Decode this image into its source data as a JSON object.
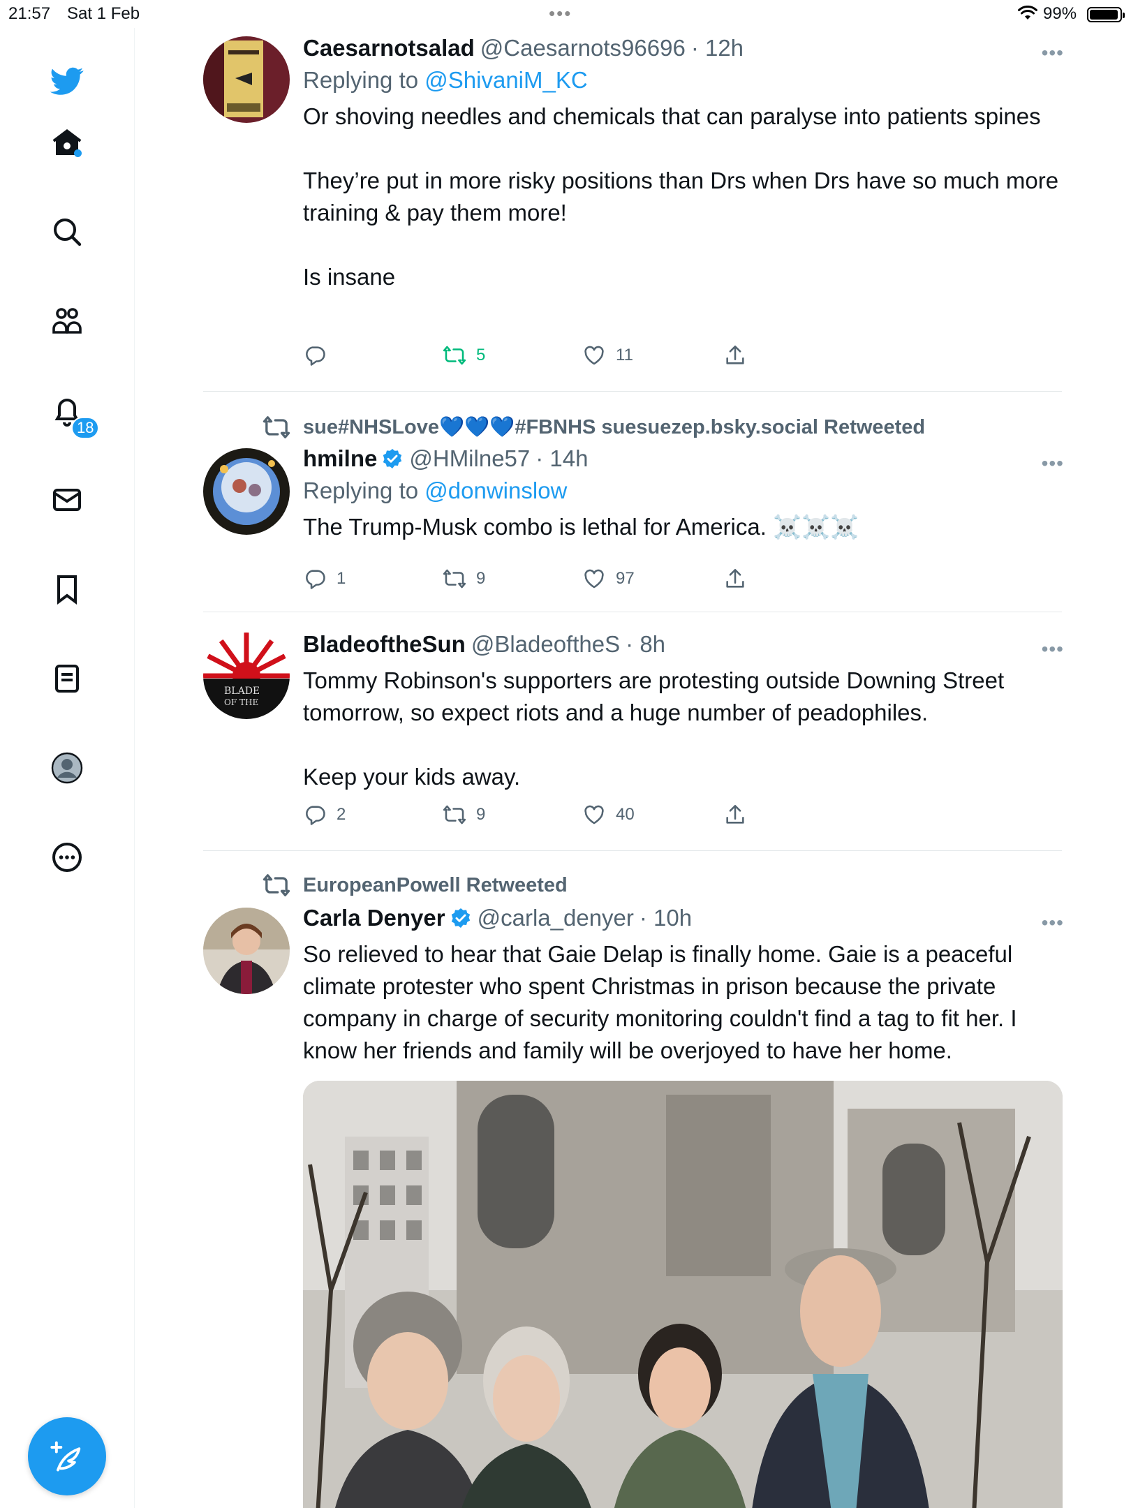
{
  "status_bar": {
    "time": "21:57",
    "date": "Sat 1 Feb",
    "battery": "99%"
  },
  "sidebar": {
    "items": [
      {
        "name": "home"
      },
      {
        "name": "search"
      },
      {
        "name": "communities"
      },
      {
        "name": "notifications",
        "badge": "18"
      },
      {
        "name": "messages"
      },
      {
        "name": "bookmarks"
      },
      {
        "name": "lists"
      },
      {
        "name": "profile"
      },
      {
        "name": "more"
      }
    ]
  },
  "tweets": [
    {
      "display_name": "Caesarnotsalad",
      "handle": "@Caesarnots96696",
      "time": "· 12h",
      "replying_label": "Replying to",
      "replying_to": "@ShivaniM_KC",
      "text": "Or shoving needles and chemicals that can paralyse into patients spines\n\nThey’re put in more risky positions than Drs when Drs have so much more training & pay them more!\n\nIs insane",
      "replies": "",
      "retweets": "5",
      "likes": "11"
    },
    {
      "retweeted_by": "sue#NHSLove💙💙💙#FBNHS suesuezep.bsky.social Retweeted",
      "display_name": "hmilne",
      "handle": "@HMilne57",
      "time": "· 14h",
      "replying_label": "Replying to",
      "replying_to": "@donwinslow",
      "text": "The Trump-Musk combo is lethal for America. ☠️☠️☠️",
      "replies": "1",
      "retweets": "9",
      "likes": "97"
    },
    {
      "display_name": "BladeoftheSun",
      "handle": "@BladeoftheS",
      "time": "· 8h",
      "text": "Tommy Robinson's supporters are protesting outside Downing Street tomorrow, so expect riots and a huge number of peadophiles.\n\nKeep your kids away.",
      "replies": "2",
      "retweets": "9",
      "likes": "40"
    },
    {
      "retweeted_by": "EuropeanPowell Retweeted",
      "display_name": "Carla Denyer",
      "handle": "@carla_denyer",
      "time": "· 10h",
      "text": "So relieved to hear that Gaie Delap is finally home. Gaie is a peaceful climate protester who spent Christmas in prison because the private company in charge of security monitoring couldn't find a tag to fit her. I know her friends and family will be overjoyed to have her home."
    }
  ],
  "colors": {
    "accent": "#1d9bf0",
    "retweet_green": "#00ba7c",
    "muted": "#536471"
  }
}
